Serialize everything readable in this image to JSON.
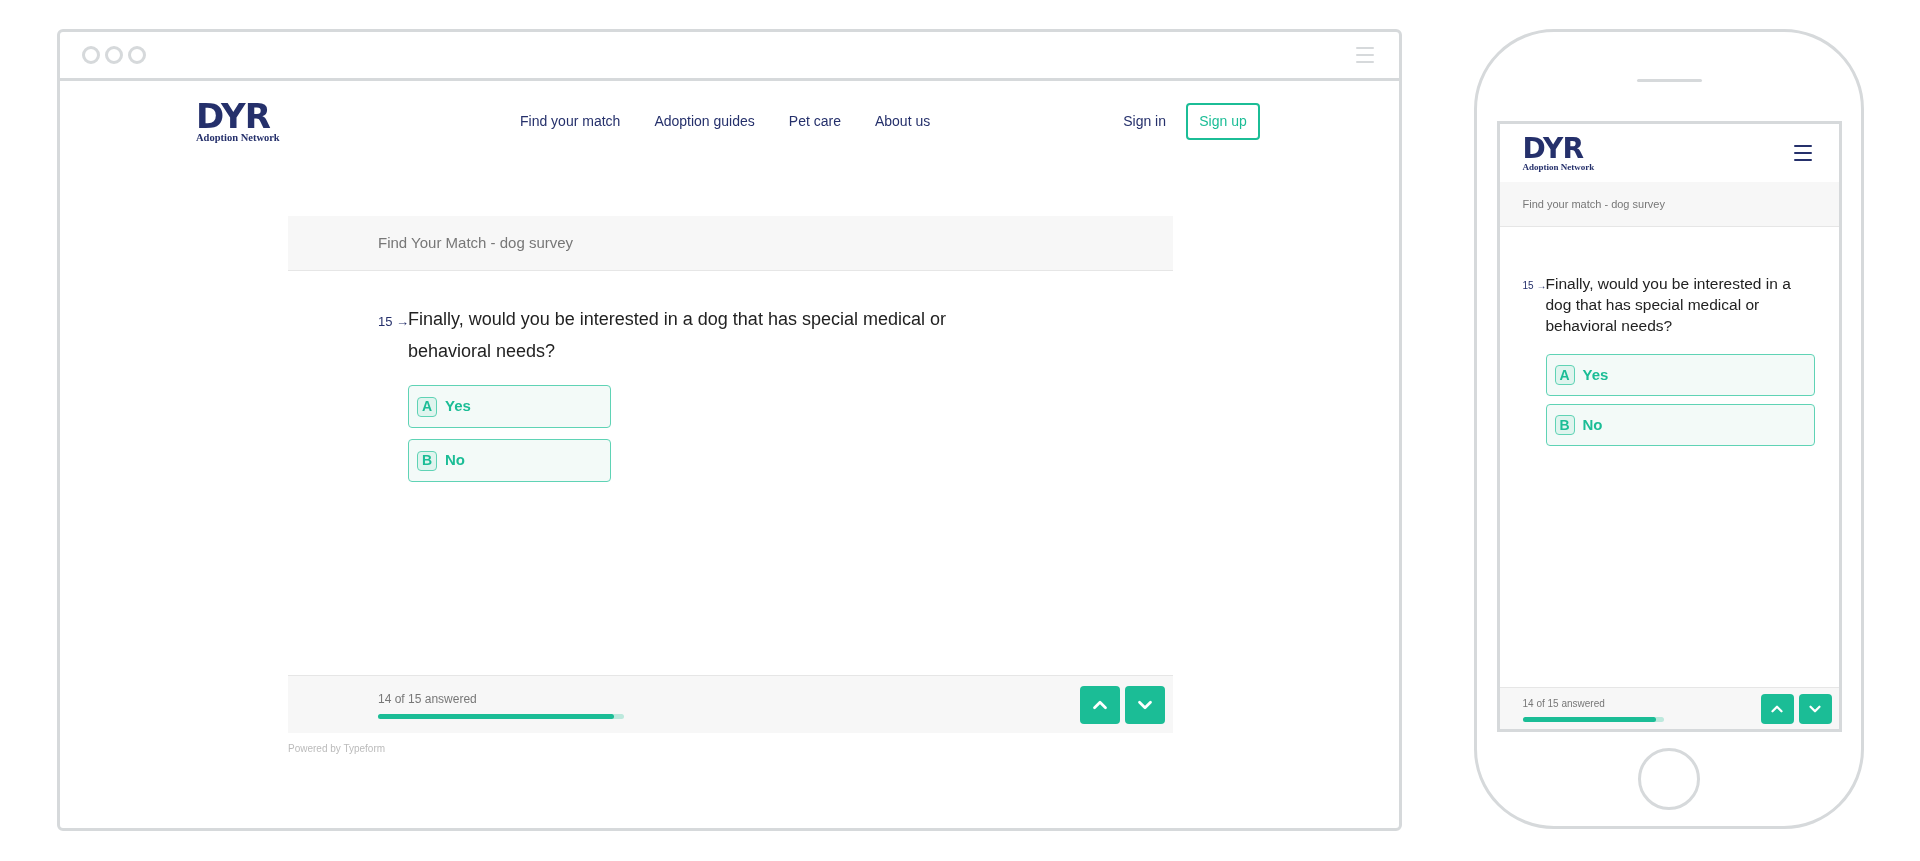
{
  "desktop": {
    "logo": {
      "mark": "DYR",
      "subtitle": "Adoption Network"
    },
    "nav": {
      "links": [
        "Find your match",
        "Adoption guides",
        "Pet care",
        "About us"
      ],
      "sign_in": "Sign in",
      "sign_up": "Sign up"
    },
    "survey": {
      "title": "Find Your Match - dog survey",
      "question": {
        "number": "15",
        "arrow": "→",
        "text": "Finally, would you be interested in a dog that has special medical or behavioral needs?"
      },
      "options": [
        {
          "key": "A",
          "label": "Yes",
          "selected": false
        },
        {
          "key": "B",
          "label": "No",
          "selected": false
        }
      ],
      "progress": {
        "text": "14 of 15 answered",
        "level": 0.96
      },
      "powered_by": "Powered by Typeform"
    }
  },
  "mobile": {
    "logo": {
      "mark": "DYR",
      "subtitle": "Adoption Network"
    },
    "survey": {
      "title": "Find your match - dog survey",
      "question": {
        "number": "15",
        "arrow": "→",
        "text": "Finally, would you be interested in a dog that has special medical or behavioral needs?"
      },
      "options": [
        {
          "key": "A",
          "label": "Yes",
          "selected": false
        },
        {
          "key": "B",
          "label": "No",
          "selected": false
        }
      ],
      "progress": {
        "text": "14 of 15 answered",
        "level": 0.95
      }
    }
  }
}
